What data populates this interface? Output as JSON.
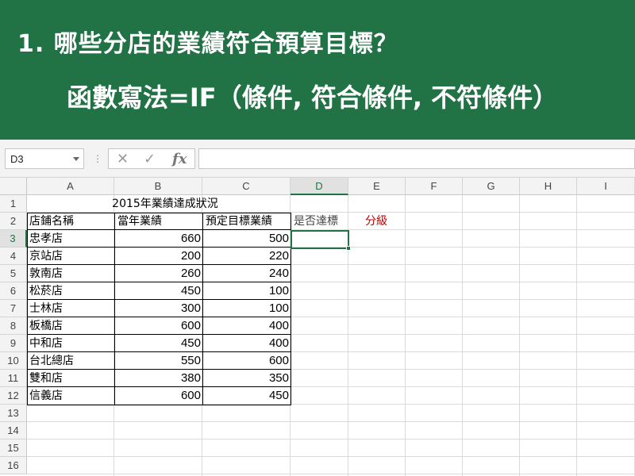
{
  "banner": {
    "title": "1. 哪些分店的業績符合預算目標？",
    "formula": "函數寫法=IF（條件, 符合條件, 不符條件）"
  },
  "formula_bar": {
    "name_box": "D3",
    "cancel_icon": "✕",
    "enter_icon": "✓",
    "fx_label": "fx",
    "content": ""
  },
  "columns": [
    "A",
    "B",
    "C",
    "D",
    "E",
    "F",
    "G",
    "H",
    "I"
  ],
  "rows": [
    "1",
    "2",
    "3",
    "4",
    "5",
    "6",
    "7",
    "8",
    "9",
    "10",
    "11",
    "12",
    "13",
    "14",
    "15",
    "16"
  ],
  "sheet": {
    "title": "2015年業績達成狀況",
    "headers": {
      "store": "店鋪名稱",
      "actual": "當年業績",
      "target": "預定目標業績",
      "achieved": "是否達標",
      "grade": "分級"
    },
    "records": [
      {
        "store": "忠孝店",
        "actual": "660",
        "target": "500"
      },
      {
        "store": "京站店",
        "actual": "200",
        "target": "220"
      },
      {
        "store": "敦南店",
        "actual": "260",
        "target": "240"
      },
      {
        "store": "松菸店",
        "actual": "450",
        "target": "100"
      },
      {
        "store": "士林店",
        "actual": "300",
        "target": "100"
      },
      {
        "store": "板橋店",
        "actual": "600",
        "target": "400"
      },
      {
        "store": "中和店",
        "actual": "450",
        "target": "400"
      },
      {
        "store": "台北總店",
        "actual": "550",
        "target": "600"
      },
      {
        "store": "雙和店",
        "actual": "380",
        "target": "350"
      },
      {
        "store": "信義店",
        "actual": "600",
        "target": "450"
      }
    ]
  },
  "colors": {
    "banner": "#217346",
    "selection": "#217346",
    "grade_header": "#c00000",
    "achieved_header": "#444444"
  }
}
